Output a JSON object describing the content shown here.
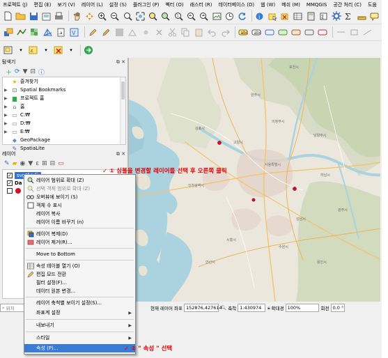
{
  "menubar": [
    "프로젝트 (J)",
    "편집 (E)",
    "보기 (V)",
    "레이어 (L)",
    "설정 (S)",
    "플러그인 (P)",
    "벡터 (O)",
    "래스터 (R)",
    "데이터베이스 (D)",
    "웹 (W)",
    "메쉬 (M)",
    "MMQGIS",
    "공간 처리 (C)",
    "도움"
  ],
  "browser": {
    "title": "탐색기",
    "items": [
      {
        "label": "즐겨찾기",
        "icon": "star-icon",
        "arrow": false
      },
      {
        "label": "Spatial Bookmarks",
        "icon": "bookmark-icon",
        "arrow": true
      },
      {
        "label": "프로젝트 홈",
        "icon": "folder-icon",
        "arrow": true
      },
      {
        "label": "홈",
        "icon": "home-icon",
        "arrow": true
      },
      {
        "label": "C:₩",
        "icon": "drive-icon",
        "arrow": true
      },
      {
        "label": "D:₩",
        "icon": "drive-icon",
        "arrow": true
      },
      {
        "label": "E:₩",
        "icon": "drive-icon",
        "arrow": true
      },
      {
        "label": "GeoPackage",
        "icon": "geopackage-icon",
        "arrow": false
      },
      {
        "label": "SpatiaLite",
        "icon": "spatialite-icon",
        "arrow": false
      }
    ]
  },
  "layers": {
    "title": "레이어",
    "rows": [
      "svg테스트",
      "Da",
      ""
    ]
  },
  "annotations": {
    "step1": "✓  ① 심볼을 변경할 레이어를 선택 후 오른쪽 클릭",
    "step2": "✓  ② \" 속성 \" 선택"
  },
  "context_menu": [
    {
      "label": "레이어 범위로 확대 (Z)",
      "icon": "zoom-layer-icon",
      "disabled": false,
      "submenu": false
    },
    {
      "label": "선택 객체 범위로 확대 (Z)",
      "icon": "zoom-selection-icon",
      "disabled": true,
      "submenu": false
    },
    {
      "label": "오버뷰에 보이기 (S)",
      "icon": "overview-icon",
      "disabled": false,
      "submenu": false
    },
    {
      "label": "객체 수 표시",
      "icon": "checkbox-icon",
      "disabled": false,
      "submenu": false
    },
    {
      "label": "레이어 복사",
      "icon": "",
      "disabled": false,
      "submenu": false
    },
    {
      "label": "레이어 이름 바꾸기 (n)",
      "icon": "",
      "disabled": false,
      "submenu": false
    },
    {
      "label": "레이어 복제(D)",
      "icon": "duplicate-icon",
      "disabled": false,
      "submenu": false
    },
    {
      "label": "레이어 제거(R)...",
      "icon": "remove-layer-icon",
      "disabled": false,
      "submenu": false
    },
    {
      "label": "Move to Bottom",
      "icon": "",
      "disabled": false,
      "submenu": false
    },
    {
      "label": "속성 테이블 열기 (O)",
      "icon": "table-icon",
      "disabled": false,
      "submenu": false
    },
    {
      "label": "편집 모드 전환",
      "icon": "pencil-icon",
      "disabled": false,
      "submenu": false
    },
    {
      "label": "필터 설정(F)...",
      "icon": "",
      "disabled": false,
      "submenu": false
    },
    {
      "label": "데이터 원본 변경...",
      "icon": "",
      "disabled": false,
      "submenu": false
    },
    {
      "label": "레이어 축척별 보이기 설정(S)...",
      "icon": "",
      "disabled": false,
      "submenu": false
    },
    {
      "label": "좌표계 설정",
      "icon": "",
      "disabled": false,
      "submenu": true
    },
    {
      "label": "내보내기",
      "icon": "",
      "disabled": false,
      "submenu": true
    },
    {
      "label": "스타일",
      "icon": "",
      "disabled": false,
      "submenu": true
    },
    {
      "label": "속성 (P)...",
      "icon": "",
      "disabled": false,
      "submenu": false,
      "highlight": true
    }
  ],
  "statusbar": {
    "locator_placeholder": "위치",
    "current_layer_label": "현재 레이어",
    "coord_label": "좌표",
    "coord_value": "152876,427614",
    "scale_label": "축척",
    "scale_value": "1:430974",
    "magnifier_label": "확대경",
    "magnifier_value": "100%",
    "rotation_label": "회전",
    "rotation_value": "0.0 °"
  },
  "map_labels": [
    "포천시",
    "양주시",
    "의정부시",
    "남양주시",
    "서울특별시",
    "하남시",
    "고양시",
    "김포시",
    "인천광역시",
    "시흥시",
    "수원시",
    "용인시",
    "광주시",
    "성남시",
    "안산시"
  ],
  "colors": {
    "selection_blue": "#3370d8",
    "menu_highlight": "#3a7bd5",
    "annotation_red": "#e00000",
    "map_land": "#ece7dc",
    "map_water": "#aad3df",
    "map_green": "#cfe3bf",
    "point_red": "#d0102a"
  }
}
